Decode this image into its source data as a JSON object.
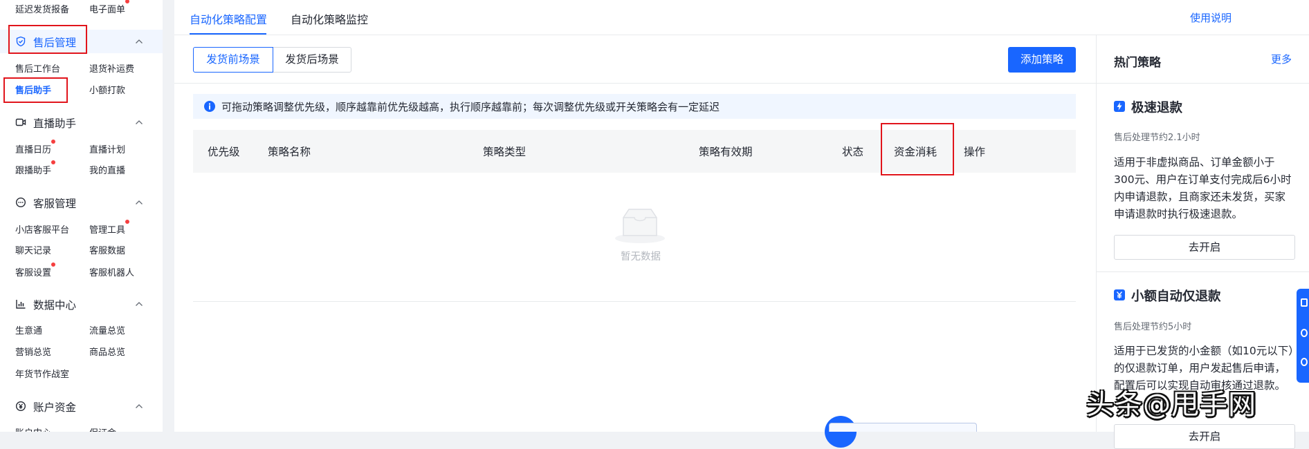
{
  "sidebar": {
    "top_items": [
      {
        "label": "延迟发货报备",
        "badge": false
      },
      {
        "label": "电子面单",
        "badge": true
      }
    ],
    "groups": [
      {
        "label": "售后管理",
        "icon": "shield-icon",
        "selected": true,
        "items": [
          {
            "label": "售后工作台",
            "badge": false,
            "active": false
          },
          {
            "label": "退货补运费",
            "badge": false,
            "active": false
          },
          {
            "label": "售后助手",
            "badge": false,
            "active": true
          },
          {
            "label": "小额打款",
            "badge": false,
            "active": false
          }
        ]
      },
      {
        "label": "直播助手",
        "icon": "video-icon",
        "selected": false,
        "items": [
          {
            "label": "直播日历",
            "badge": true,
            "active": false
          },
          {
            "label": "直播计划",
            "badge": false,
            "active": false
          },
          {
            "label": "跟播助手",
            "badge": true,
            "active": false
          },
          {
            "label": "我的直播",
            "badge": false,
            "active": false
          }
        ]
      },
      {
        "label": "客服管理",
        "icon": "chat-icon",
        "selected": false,
        "items": [
          {
            "label": "小店客服平台",
            "badge": false,
            "active": false
          },
          {
            "label": "管理工具",
            "badge": true,
            "active": false
          },
          {
            "label": "聊天记录",
            "badge": false,
            "active": false
          },
          {
            "label": "客服数据",
            "badge": false,
            "active": false
          },
          {
            "label": "客服设置",
            "badge": true,
            "active": false
          },
          {
            "label": "客服机器人",
            "badge": false,
            "active": false
          }
        ]
      },
      {
        "label": "数据中心",
        "icon": "bar-chart-icon",
        "selected": false,
        "items": [
          {
            "label": "生意通",
            "badge": false,
            "active": false
          },
          {
            "label": "流量总览",
            "badge": false,
            "active": false
          },
          {
            "label": "营销总览",
            "badge": false,
            "active": false
          },
          {
            "label": "商品总览",
            "badge": false,
            "active": false
          },
          {
            "label": "年货节作战室",
            "badge": false,
            "active": false
          }
        ]
      },
      {
        "label": "账户资金",
        "icon": "yen-icon",
        "selected": false,
        "items": [
          {
            "label": "账户中心",
            "badge": false,
            "active": false
          },
          {
            "label": "保证金",
            "badge": false,
            "active": false
          }
        ]
      }
    ]
  },
  "tabs": [
    {
      "label": "自动化策略配置",
      "active": true
    },
    {
      "label": "自动化策略监控",
      "active": false
    }
  ],
  "help_link": "使用说明",
  "scene_tabs": [
    {
      "label": "发货前场景",
      "active": true
    },
    {
      "label": "发货后场景",
      "active": false
    }
  ],
  "add_button": "添加策略",
  "notice": "可拖动策略调整优先级，顺序越靠前优先级越高，执行顺序越靠前；每次调整优先级或开关策略会有一定延迟",
  "table": {
    "columns": [
      "优先级",
      "策略名称",
      "策略类型",
      "策略有效期",
      "状态",
      "资金消耗",
      "操作"
    ],
    "empty_text": "暂无数据"
  },
  "hot": {
    "title": "热门策略",
    "more": "更多",
    "cards": [
      {
        "title": "极速退款",
        "icon": "lightning-icon",
        "subtitle": "售后处理节约2.1小时",
        "description": "适用于非虚拟商品、订单金额小于300元、用户在订单支付完成后6小时内申请退款，且商家还未发货，买家申请退款时执行极速退款。",
        "button": "去开启"
      },
      {
        "title": "小额自动仅退款",
        "icon": "yen-card-icon",
        "subtitle": "售后处理节约5小时",
        "description": "适用于已发货的小金额（如10元以下）的仅退款订单，用户发起售后申请，配置后可以实现自动审核通过退款。",
        "button": "去开启"
      }
    ]
  },
  "watermark": "头条@甩手网",
  "colors": {
    "accent": "#1966ff",
    "badge": "#f53f3f",
    "highlight_box": "#e1141b"
  }
}
